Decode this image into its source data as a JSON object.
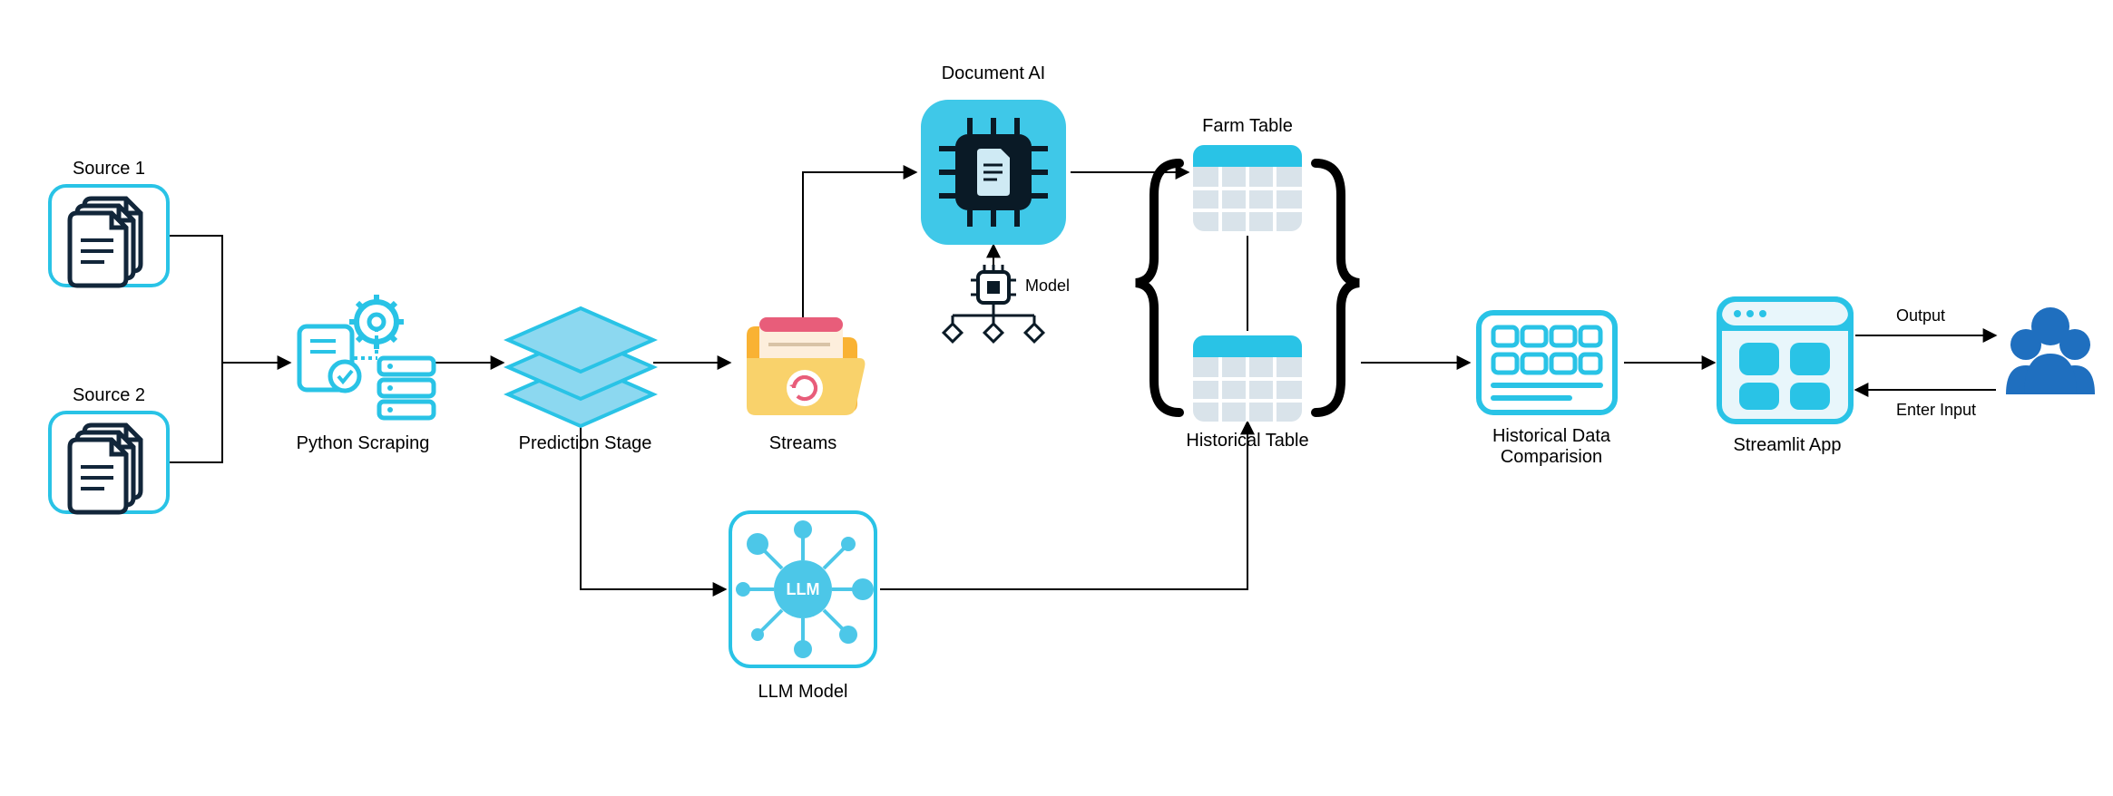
{
  "nodes": {
    "source1": {
      "label": "Source 1"
    },
    "source2": {
      "label": "Source 2"
    },
    "pythonScraping": {
      "label": "Python Scraping"
    },
    "predictionStage": {
      "label": "Prediction Stage"
    },
    "streams": {
      "label": "Streams"
    },
    "documentAI": {
      "label": "Document AI"
    },
    "model": {
      "label": "Model"
    },
    "llmModel": {
      "label": "LLM Model"
    },
    "farmTable": {
      "label": "Farm Table"
    },
    "historicalTable": {
      "label": "Historical Table"
    },
    "historicalDataComparison": {
      "label": "Historical Data\nComparision"
    },
    "streamlitApp": {
      "label": "Streamlit App"
    },
    "users": {
      "label": ""
    }
  },
  "edgeLabels": {
    "output": "Output",
    "enterInput": "Enter Input"
  },
  "colors": {
    "accent": "#29c3e6",
    "accentLight": "#8cd8f0",
    "docAiBg": "#3fc8e8",
    "folderBody": "#f9b233",
    "folderFront": "#f9d26b",
    "folderPaper": "#fdeedc",
    "folderPink": "#e85d7a",
    "tableHeader": "#29c3e6",
    "tableBody": "#d9e3ea",
    "userBlue": "#1f6fbf",
    "gearGrey": "#8fa7b3"
  }
}
